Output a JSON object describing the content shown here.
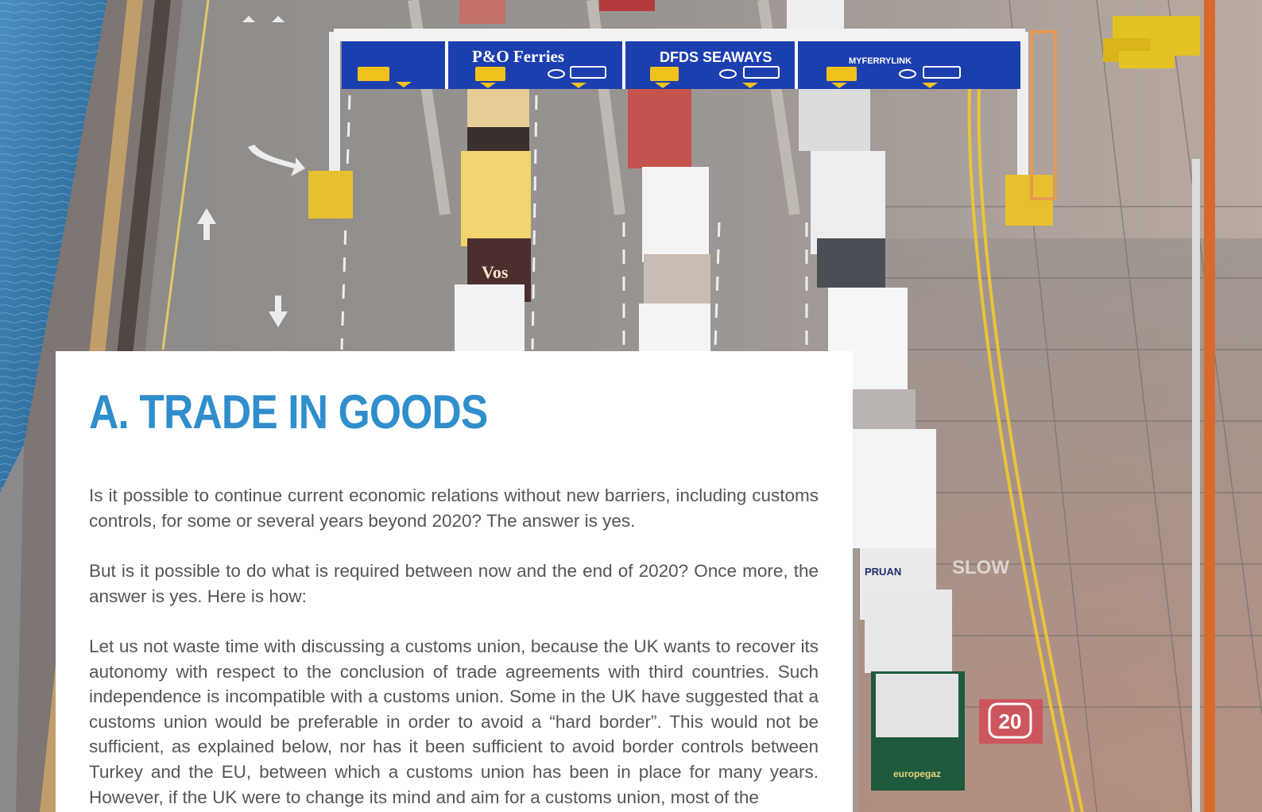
{
  "gantry_sign": {
    "operators": [
      "P&O Ferries",
      "DFDS SEAWAYS",
      "MYFERRYLINK"
    ]
  },
  "road_markings": {
    "speed_limit": "20",
    "slow_marking": "SLOW"
  },
  "truck_labels": [
    "Vos",
    "PRUAN",
    "europegaz"
  ],
  "article": {
    "heading": "A. TRADE IN GOODS",
    "paragraphs": [
      "Is it possible to continue current economic relations without new barriers, including customs controls, for some or several years beyond 2020? The answer is yes.",
      "But is it possible to do what is required between now and the end of 2020? Once more, the answer is yes. Here is how:",
      "Let us not waste time with discussing a customs union, because the UK wants to recover its autonomy with respect to the conclusion of trade agreements with third countries. Such independence is incompatible with a customs union. Some in the UK have suggested that a customs union would be preferable in order to avoid a “hard border”. This would not be sufficient, as explained below, nor has it been sufficient to avoid border controls between Turkey and the EU, between which a customs union has been in place for many years. However, if the UK were to change its mind and aim for a customs union, most of the"
    ]
  },
  "colors": {
    "heading": "#2f8ecb",
    "body_text": "#555558",
    "sign_blue": "#1c3fb0",
    "sea": "#2f6fa3"
  }
}
